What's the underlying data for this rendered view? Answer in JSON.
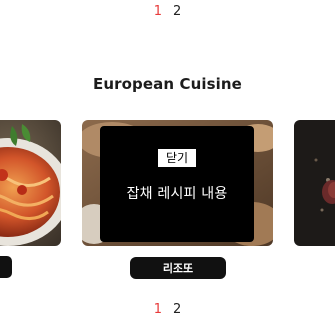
{
  "pagination_top": {
    "page1": "1",
    "page2": "2",
    "active_color": "#e83b3b"
  },
  "section": {
    "title": "European Cuisine"
  },
  "cards": [
    {
      "image": "spaghetti-dish-image"
    },
    {
      "image": "risotto-dish-image",
      "label": "리조또"
    },
    {
      "image": "dark-dish-image"
    }
  ],
  "overlay": {
    "close_label": "닫기",
    "content": "잡채 레시피 내용"
  },
  "pagination_bottom": {
    "page1": "1",
    "page2": "2"
  }
}
